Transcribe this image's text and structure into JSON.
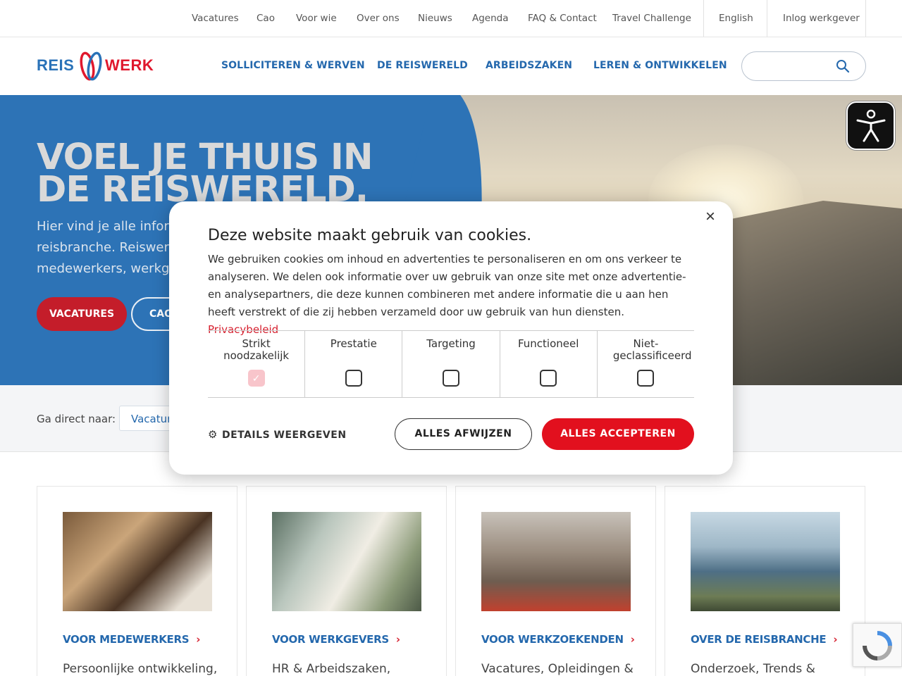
{
  "topnav": {
    "items": [
      "Vacatures",
      "Cao",
      "Voor wie",
      "Over ons",
      "Nieuws",
      "Agenda",
      "FAQ & Contact",
      "Travel Challenge"
    ],
    "language": "English",
    "login": "Inlog werkgever"
  },
  "logo": {
    "left": "REIS",
    "right": "WERK"
  },
  "mainnav": {
    "items": [
      "SOLLICITEREN & WERVEN",
      "DE REISWERELD",
      "ARBEIDSZAKEN",
      "LEREN & ONTWIKKELEN"
    ],
    "search_placeholder": ""
  },
  "hero": {
    "title_line1": "VOEL JE THUIS IN",
    "title_line2": "DE REISWERELD.",
    "intro_line1": "Hier vind je alle inforn",
    "intro_line2": "reisbranche. Reiswerk",
    "intro_line3": "medewerkers, werkge",
    "btn_primary": "VACATURES",
    "btn_secondary": "CAO"
  },
  "quicklinks": {
    "label": "Ga direct naar:",
    "select_value": "Vacatur"
  },
  "cards": [
    {
      "title": "VOOR MEDEWERKERS",
      "desc": "Persoonlijke ontwikkeling,"
    },
    {
      "title": "VOOR WERKGEVERS",
      "desc": "HR & Arbeidszaken,"
    },
    {
      "title": "VOOR WERKZOEKENDEN",
      "desc": "Vacatures, Opleidingen &"
    },
    {
      "title": "OVER DE REISBRANCHE",
      "desc": "Onderzoek, Trends &"
    }
  ],
  "cookie": {
    "title": "Deze website maakt gebruik van cookies.",
    "body": "We gebruiken cookies om inhoud en advertenties te personaliseren en om ons verkeer te analyseren. We delen ook informatie over uw gebruik van onze site met onze advertentie- en analysepartners, die deze kunnen combineren met andere informatie die u aan hen heeft verstrekt of die zij hebben verzameld door uw gebruik van hun diensten.",
    "privacy_link": "Privacybeleid",
    "categories": [
      {
        "name": "Strikt noodzakelijk",
        "checked": true
      },
      {
        "name": "Prestatie",
        "checked": false
      },
      {
        "name": "Targeting",
        "checked": false
      },
      {
        "name": "Functioneel",
        "checked": false
      },
      {
        "name": "Niet-geclassificeerd",
        "checked": false
      }
    ],
    "details": "DETAILS WEERGEVEN",
    "reject": "ALLES AFWIJZEN",
    "accept": "ALLES ACCEPTEREN",
    "close_symbol": "×"
  },
  "colors": {
    "brand_blue": "#2468ad",
    "brand_red": "#e2101e",
    "hero_blue": "#2d73b6"
  }
}
